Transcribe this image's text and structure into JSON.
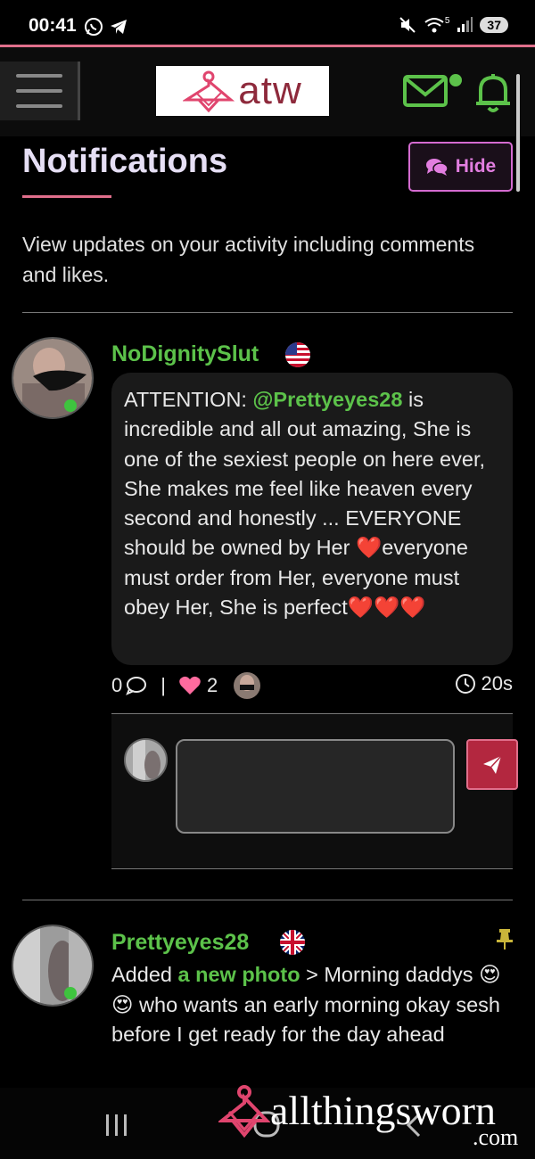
{
  "status_bar": {
    "time": "00:41",
    "network": "5",
    "battery": "37"
  },
  "header": {
    "logo_text": "atw"
  },
  "page": {
    "title": "Notifications",
    "hide_label": "Hide",
    "description": "View updates on your activity including comments and likes."
  },
  "notifications": [
    {
      "username": "NoDignitySlut",
      "flag": "us-flag",
      "comment_parts": {
        "prefix": "ATTENTION: ",
        "mention": "@Prettyeyes28",
        "body1": " is incredible and all out amazing, She is one of the sexiest people on here ever, She makes me feel like heaven every second and honestly ... EVERYONE should be owned by Her ",
        "heart1": "❤️",
        "body2": "everyone must order from Her, everyone must obey Her, She is perfect",
        "hearts_end": "❤️❤️❤️"
      },
      "reply_count": "0",
      "like_count": "2",
      "time_ago": "20s"
    },
    {
      "username": "Prettyeyes28",
      "flag": "uk-flag",
      "action_prefix": "Added ",
      "action_link": "a new photo",
      "action_suffix": " > Morning daddys ",
      "emoji": "😍😍",
      "post_text": " who wants an early morning okay sesh before I get ready for the day ahead"
    }
  ],
  "watermark": {
    "text": "allthingsworn",
    "suffix": ".com"
  },
  "colors": {
    "accent_pink": "#e06f8b",
    "username_green": "#5cc24a",
    "hide_purple": "#d46bd0",
    "send_red": "#b3273f"
  }
}
